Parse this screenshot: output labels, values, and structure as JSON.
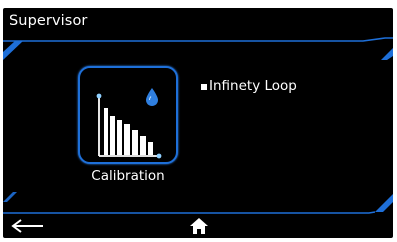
{
  "header": {
    "title": "Supervisor"
  },
  "main": {
    "tile": {
      "label": "Calibration",
      "icon": "bar-chart-droplet-icon"
    },
    "side_items": [
      {
        "label": "Infinety Loop"
      }
    ]
  },
  "footer": {
    "back_icon": "back-arrow-icon",
    "home_icon": "home-icon"
  },
  "colors": {
    "background": "#000000",
    "accent": "#1e6fd8",
    "accent_light": "#4aa3ff",
    "text": "#ffffff"
  }
}
